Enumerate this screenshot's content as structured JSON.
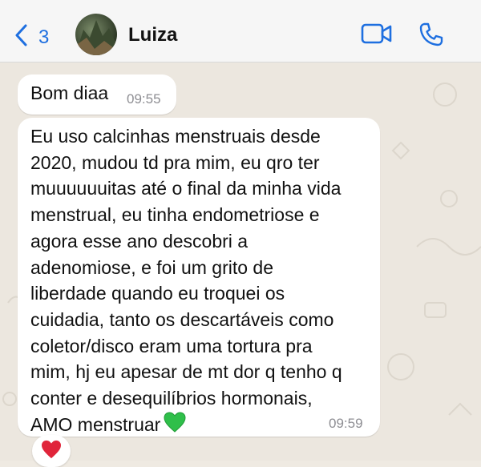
{
  "header": {
    "back_count": "3",
    "contact_name": "Luiza",
    "icons": {
      "back": "chevron-left-icon",
      "video": "video-call-icon",
      "phone": "phone-icon"
    },
    "accent_color": "#1e6fe0"
  },
  "messages": [
    {
      "text": "Bom diaa",
      "time": "09:55"
    },
    {
      "text": "Eu uso calcinhas menstruais desde\n2020, mudou td pra mim, eu qro ter\nmuuuuuuitas até o final da minha vida\nmenstrual, eu tinha endometriose e\nagora esse ano descobri a\nadenomiose, e foi um grito de\nliberdade quando eu troquei os\ncuidadia, tanto os descartáveis como\ncoletor/disco eram uma tortura pra\nmim, hj eu apesar de mt dor q tenho q\nconter e desequilíbrios hormonais,\nAMO menstruar",
      "emoji": "green-heart-icon",
      "time": "09:59",
      "reaction": "red-heart-icon"
    }
  ]
}
